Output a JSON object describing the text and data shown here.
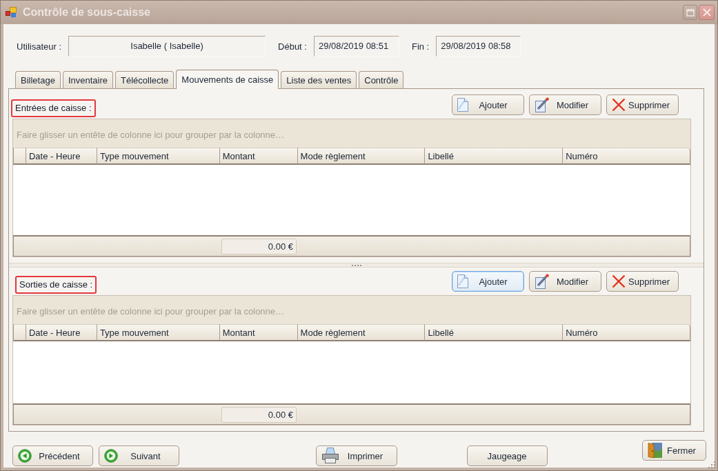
{
  "window": {
    "title": "Contrôle de sous-caisse"
  },
  "fields": [
    {
      "label": "Utilisateur :",
      "value": "Isabelle ( Isabelle)"
    },
    {
      "label": "Début :",
      "value": "29/08/2019 08:51"
    },
    {
      "label": "Fin :",
      "value": "29/08/2019 08:58"
    }
  ],
  "tabs": [
    {
      "label": "Billetage",
      "selected": false
    },
    {
      "label": "Inventaire",
      "selected": false
    },
    {
      "label": "Télécollecte",
      "selected": false
    },
    {
      "label": "Mouvements de caisse",
      "selected": true
    },
    {
      "label": "Liste des ventes",
      "selected": false
    },
    {
      "label": "Contrôle",
      "selected": false
    }
  ],
  "sections": [
    {
      "title": "Entrées de caisse :",
      "highlighted": true,
      "buttons": [
        {
          "label": "Ajouter",
          "focused": false
        },
        {
          "label": "Modifier",
          "focused": false
        },
        {
          "label": "Supprimer",
          "focused": false
        }
      ],
      "grid": {
        "group_hint": "Faire glisser un entête de colonne ici pour grouper par la colonne…",
        "columns": [
          "Date - Heure",
          "Type mouvement",
          "Montant",
          "Mode règlement",
          "Libellé",
          "Numéro"
        ],
        "total": "0.00 €"
      }
    },
    {
      "title": "Sorties de caisse :",
      "highlighted": true,
      "buttons": [
        {
          "label": "Ajouter",
          "focused": true
        },
        {
          "label": "Modifier",
          "focused": false
        },
        {
          "label": "Supprimer",
          "focused": false
        }
      ],
      "grid": {
        "group_hint": "Faire glisser un entête de colonne ici pour grouper par la colonne…",
        "columns": [
          "Date - Heure",
          "Type mouvement",
          "Montant",
          "Mode règlement",
          "Libellé",
          "Numéro"
        ],
        "total": "0.00 €"
      }
    }
  ],
  "footer_buttons": [
    {
      "label": "Précédent"
    },
    {
      "label": "Suivant"
    },
    {
      "label": "Imprimer"
    },
    {
      "label": "Jaugeage"
    },
    {
      "label": "Fermer"
    }
  ]
}
